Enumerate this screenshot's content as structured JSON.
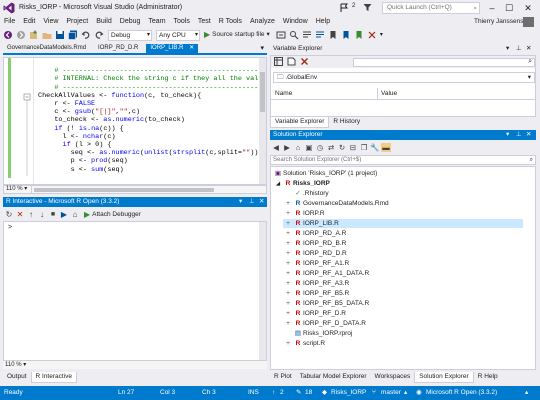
{
  "window": {
    "title": "Risks_IORP - Microsoft Visual Studio (Administrator)",
    "quick_launch_placeholder": "Quick Launch (Ctrl+Q)",
    "user": "Thierry Janssens",
    "notification_count": "2"
  },
  "menu": [
    "File",
    "Edit",
    "View",
    "Project",
    "Build",
    "Debug",
    "Team",
    "Tools",
    "Test",
    "R Tools",
    "Analyze",
    "Window",
    "Help"
  ],
  "toolbar": {
    "config": "Debug",
    "platform": "Any CPU",
    "start_label": "Source startup file"
  },
  "doc_tabs": [
    {
      "label": "GovernanceDataModels.Rmd",
      "active": false
    },
    {
      "label": "IORP_RD_D.R",
      "active": false
    },
    {
      "label": "IORP_LIB.R",
      "active": true
    }
  ],
  "editor": {
    "zoom": "110 %",
    "lines": [
      "    # --------------------------------------------------",
      "    # INTERNAL: Check the string c if they all the value",
      "    # --------------------------------------------------",
      "CheckAllValues <- function(c, to_check){",
      "    r <- FALSE",
      "    c <- gsub(\"[|]\",\"\",c)",
      "    to_check <- as.numeric(to_check)",
      "    if (! is.na(c)) {",
      "      l <- nchar(c)",
      "      if (l > 0) {",
      "        seq <- as.numeric(unlist(strsplit(c,split=\"\")))",
      "        p <- prod(seq)",
      "        s <- sum(seq)",
      "        "
    ]
  },
  "r_interactive": {
    "title": "R Interactive - Microsoft R Open (3.3.2)",
    "attach_label": "Attach Debugger",
    "prompt": ">",
    "zoom": "110 %"
  },
  "bottom_left_tabs": [
    {
      "label": "Output",
      "active": false
    },
    {
      "label": "R Interactive",
      "active": true
    }
  ],
  "variable_explorer": {
    "title": "Variable Explorer",
    "environment": ".GlobalEnv",
    "col_name": "Name",
    "col_value": "Value",
    "tabs": [
      {
        "label": "Variable Explorer",
        "active": true
      },
      {
        "label": "R History",
        "active": false
      }
    ]
  },
  "solution_explorer": {
    "title": "Solution Explorer",
    "search_placeholder": "Search Solution Explorer (Ctrl+$)",
    "solution": "Solution 'Risks_IORP' (1 project)",
    "project": "Risks_IORP",
    "items": [
      {
        "name": ".Rhistory",
        "icon": "file-icon",
        "selected": false
      },
      {
        "name": "GovernanceDataModels.Rmd",
        "icon": "rmd-icon",
        "selected": false
      },
      {
        "name": "IORP.R",
        "icon": "r-file-icon",
        "selected": false
      },
      {
        "name": "IORP_LIB.R",
        "icon": "r-file-icon",
        "selected": true
      },
      {
        "name": "IORP_RD_A.R",
        "icon": "r-file-icon",
        "selected": false
      },
      {
        "name": "IORP_RD_B.R",
        "icon": "r-file-icon",
        "selected": false
      },
      {
        "name": "IORP_RD_D.R",
        "icon": "r-file-icon",
        "selected": false
      },
      {
        "name": "IORP_RF_A1.R",
        "icon": "r-file-icon",
        "selected": false
      },
      {
        "name": "IORP_RF_A1_DATA.R",
        "icon": "r-file-icon",
        "selected": false
      },
      {
        "name": "IORP_RF_A3.R",
        "icon": "r-file-icon",
        "selected": false
      },
      {
        "name": "IORP_RF_B5.R",
        "icon": "r-file-icon",
        "selected": false
      },
      {
        "name": "IORP_RF_B5_DATA.R",
        "icon": "r-file-icon",
        "selected": false
      },
      {
        "name": "IORP_RF_D.R",
        "icon": "r-file-icon",
        "selected": false
      },
      {
        "name": "IORP_RF_D_DATA.R",
        "icon": "r-file-icon",
        "selected": false
      },
      {
        "name": "Risks_IORP.rproj",
        "icon": "rproj-icon",
        "selected": false
      },
      {
        "name": "script.R",
        "icon": "r-file-icon",
        "selected": false
      }
    ],
    "bottom_tabs": [
      {
        "label": "R Plot",
        "active": false
      },
      {
        "label": "Tabular Model Explorer",
        "active": false
      },
      {
        "label": "Workspaces",
        "active": false
      },
      {
        "label": "Solution Explorer",
        "active": true
      },
      {
        "label": "R Help",
        "active": false
      }
    ]
  },
  "status": {
    "ready": "Ready",
    "ln": "Ln 27",
    "col": "Col 3",
    "ch": "Ch 3",
    "ins": "INS",
    "up": "2",
    "pencil": "18",
    "repo": "Risks_IORP",
    "branch": "master",
    "r_version": "Microsoft R Open (3.3.2)"
  },
  "colors": {
    "accent": "#007acc",
    "vs_purple": "#68217a",
    "r_red": "#c00000"
  }
}
